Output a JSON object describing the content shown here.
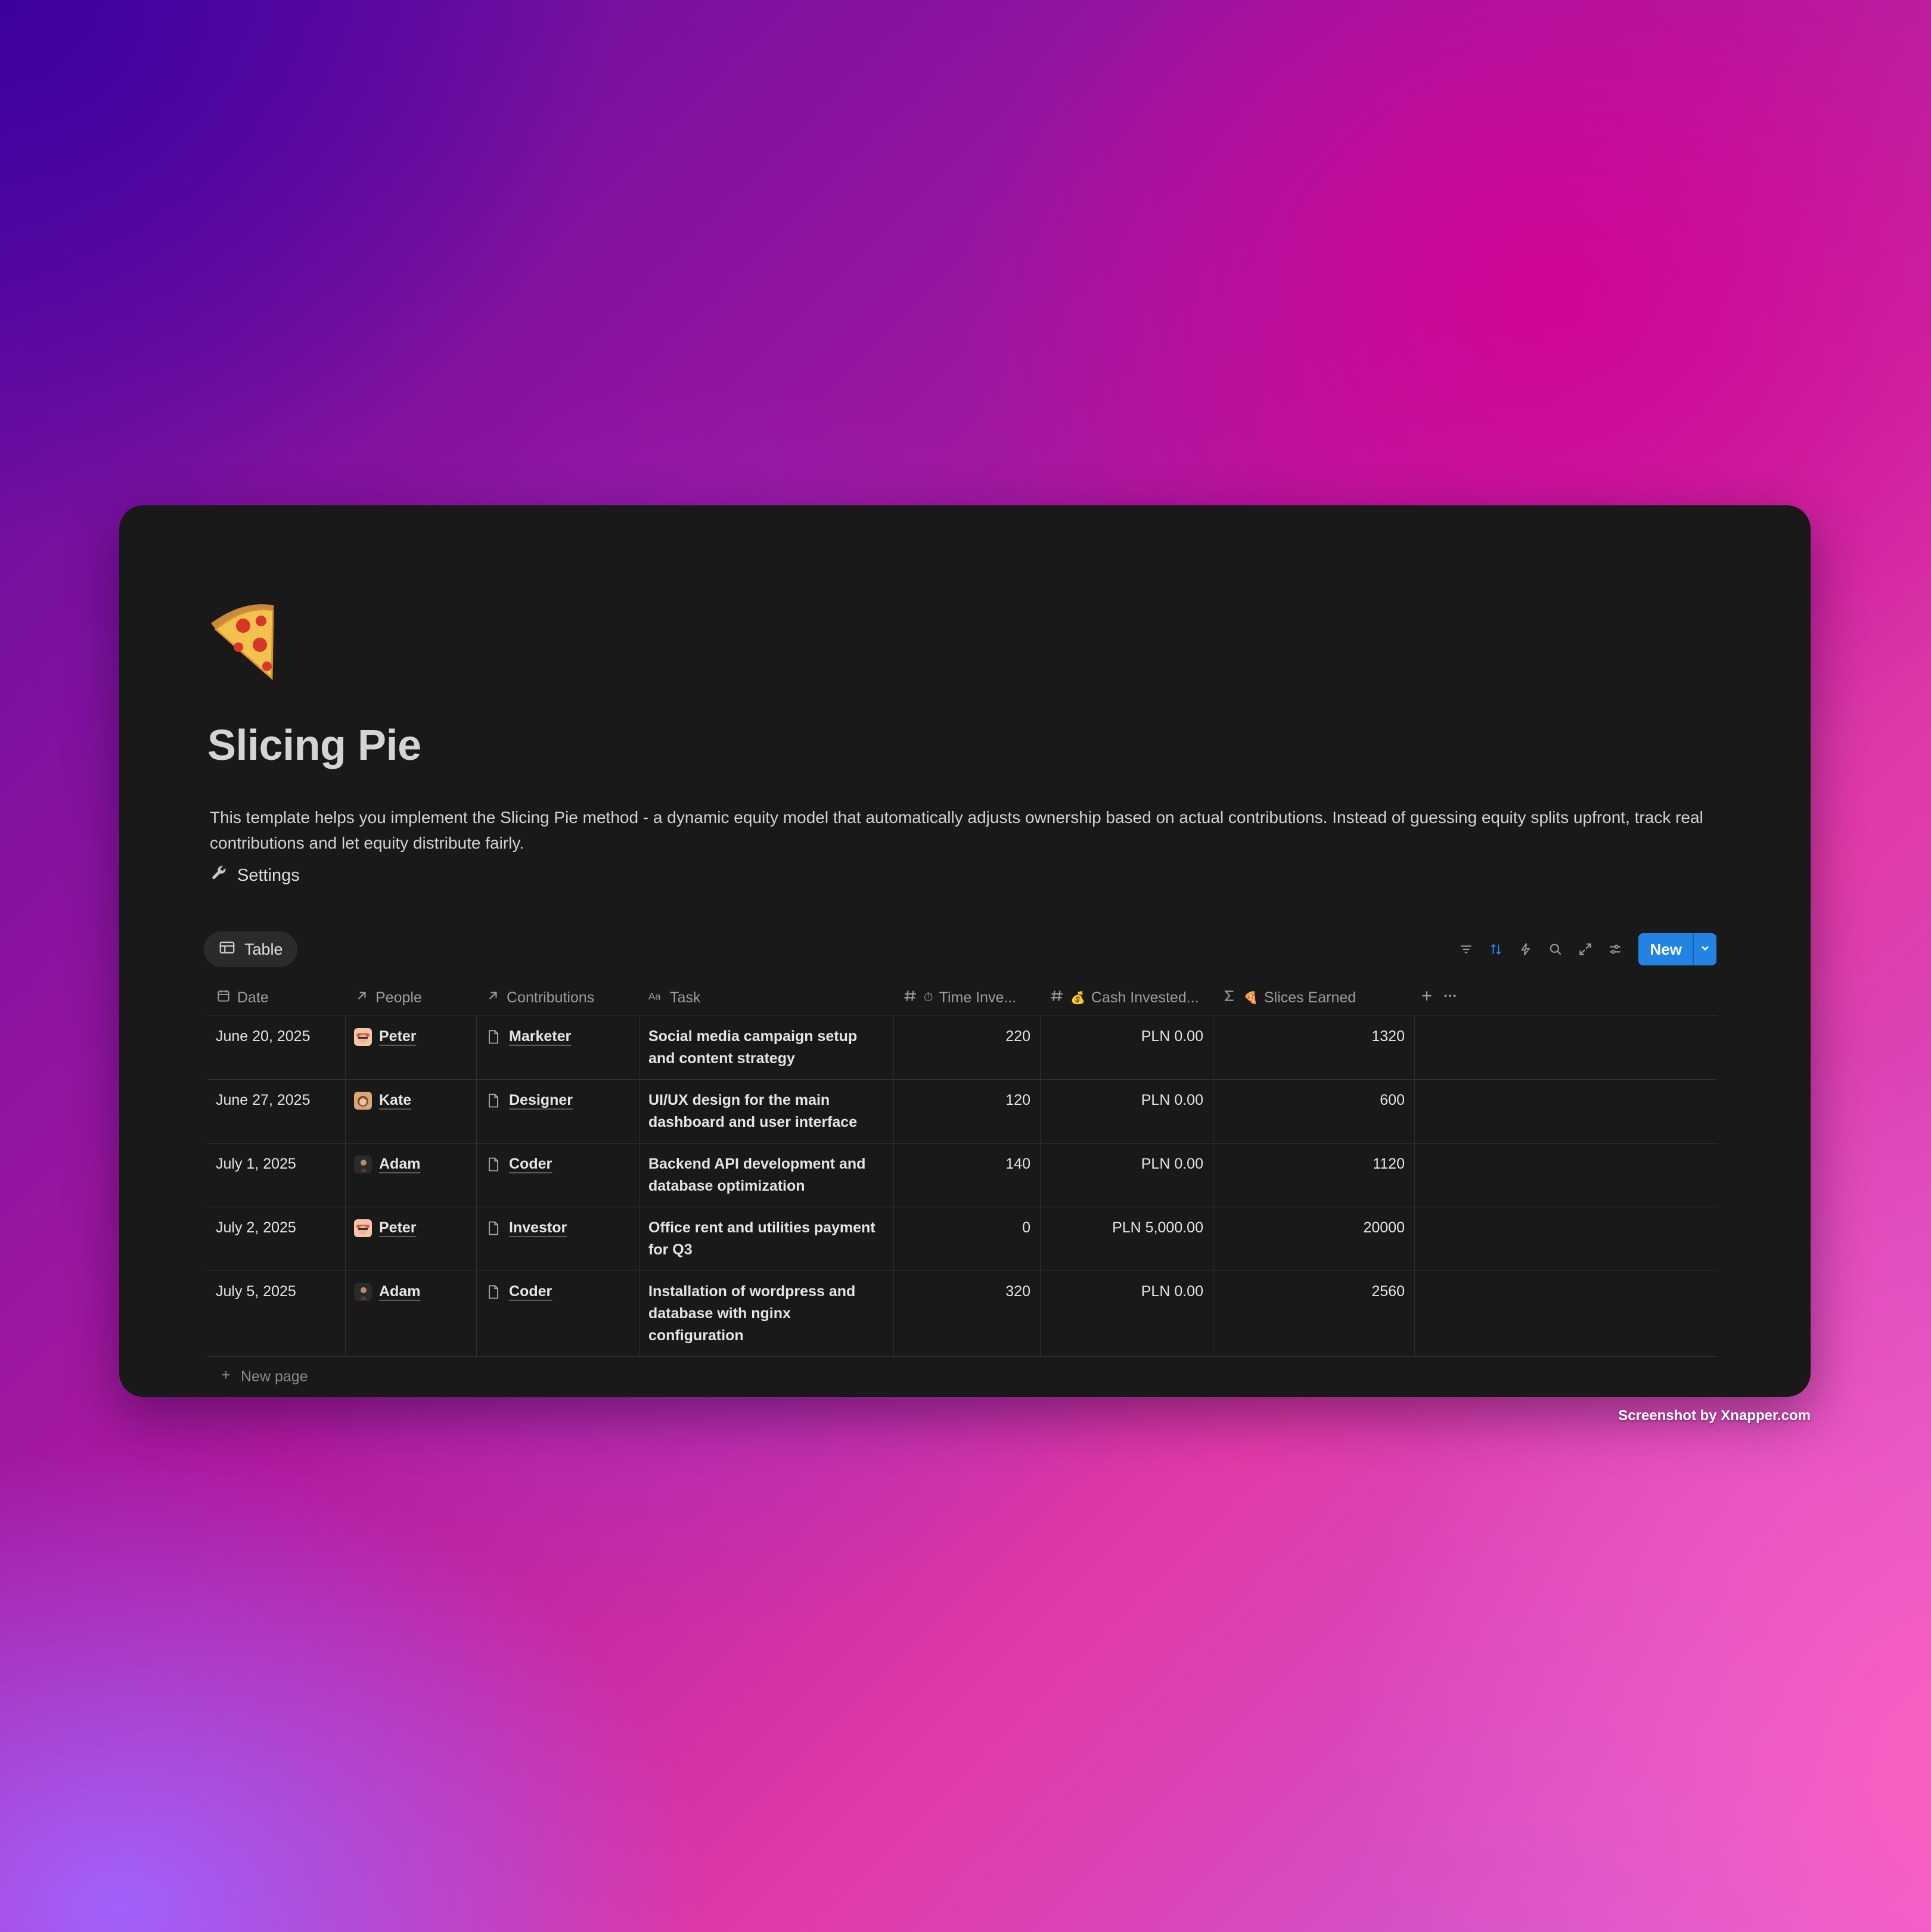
{
  "page": {
    "icon": "pizza-icon",
    "title": "Slicing Pie",
    "description": "This template helps you implement the Slicing Pie method - a dynamic equity model that automatically adjusts ownership based on actual contributions. Instead of guessing equity splits upfront, track real contributions and let equity distribute fairly.",
    "settings_label": "Settings",
    "settings_icon": "wrench-icon"
  },
  "view": {
    "tab_label": "Table",
    "tab_icon": "table-icon"
  },
  "toolbar": {
    "icons": [
      "filter-icon",
      "sort-icon",
      "lightning-icon",
      "search-icon",
      "expand-icon",
      "settings-sliders-icon"
    ],
    "new_label": "New",
    "accent": "#2383e2"
  },
  "table": {
    "columns": [
      {
        "label": "Date",
        "icon": "calendar-icon"
      },
      {
        "label": "People",
        "icon": "relation-arrow-icon"
      },
      {
        "label": "Contributions",
        "icon": "relation-arrow-icon"
      },
      {
        "label": "Task",
        "icon": "text-aa-icon"
      },
      {
        "label": "Time Inve...",
        "icon": "number-hash-icon",
        "emoji": "⏱"
      },
      {
        "label": "Cash Invested...",
        "icon": "number-hash-icon",
        "emoji": "💰"
      },
      {
        "label": "Slices Earned",
        "icon": "sigma-icon",
        "emoji": "🍕"
      }
    ],
    "rows": [
      {
        "date": "June 20, 2025",
        "person": "Peter",
        "contribution": "Marketer",
        "task": "Social media campaign setup and content strategy",
        "time": "220",
        "cash": "PLN 0.00",
        "slices": "1320"
      },
      {
        "date": "June 27, 2025",
        "person": "Kate",
        "contribution": "Designer",
        "task": "UI/UX design for the main dashboard and user interface",
        "time": "120",
        "cash": "PLN 0.00",
        "slices": "600"
      },
      {
        "date": "July 1, 2025",
        "person": "Adam",
        "contribution": "Coder",
        "task": "Backend API development and database optimization",
        "time": "140",
        "cash": "PLN 0.00",
        "slices": "1120"
      },
      {
        "date": "July 2, 2025",
        "person": "Peter",
        "contribution": "Investor",
        "task": "Office rent and utilities payment for Q3",
        "time": "0",
        "cash": "PLN 5,000.00",
        "slices": "20000"
      },
      {
        "date": "July 5, 2025",
        "person": "Adam",
        "contribution": "Coder",
        "task": "Installation of wordpress and database with nginx configuration",
        "time": "320",
        "cash": "PLN 0.00",
        "slices": "2560"
      }
    ],
    "new_page_label": "New page"
  },
  "credit": "Screenshot by Xnapper.com"
}
